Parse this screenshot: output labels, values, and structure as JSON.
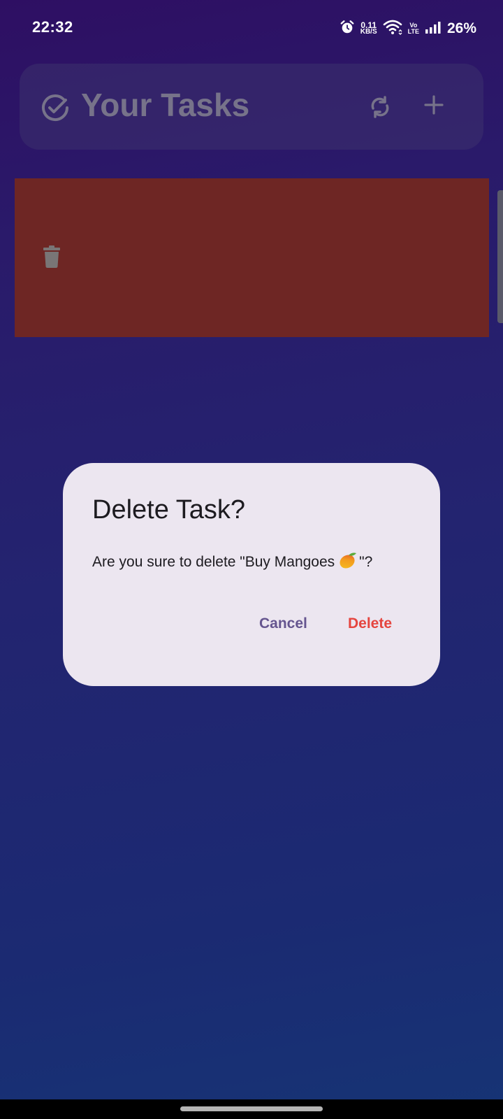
{
  "status_bar": {
    "time": "22:32",
    "net_speed_value": "0.11",
    "net_speed_unit": "KB/S",
    "volte_top": "Vo",
    "volte_bottom": "LTE",
    "battery": "26%",
    "icons": [
      "alarm-icon",
      "wifi-icon",
      "signal-icon"
    ]
  },
  "header": {
    "title": "Your Tasks",
    "icons": [
      "check-circle-icon",
      "sync-icon",
      "add-icon"
    ],
    "icon_color": "#77738a"
  },
  "swipe_action": {
    "icon": "trash-icon",
    "background_color": "#6e2624"
  },
  "dialog": {
    "title": "Delete Task?",
    "message_prefix": "Are you sure to delete \"Buy Mangoes",
    "message_emoji": "mango-icon",
    "message_suffix": "\"?",
    "cancel_label": "Cancel",
    "delete_label": "Delete",
    "cancel_color": "#65558f",
    "delete_color": "#e5453f",
    "background_color": "#ece6f0"
  }
}
